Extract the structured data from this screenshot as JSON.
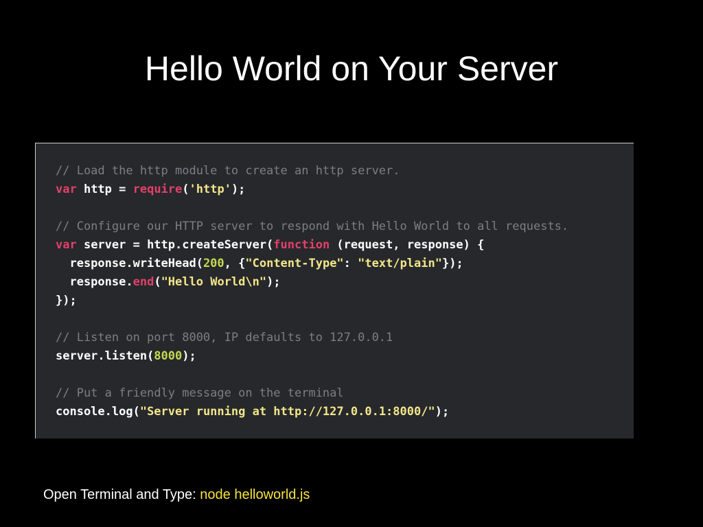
{
  "slide": {
    "title": "Hello World on Your Server"
  },
  "code": {
    "lines": [
      [
        {
          "t": "// Load the http module to create an http server.",
          "k": "comment"
        }
      ],
      [
        {
          "t": "var",
          "k": "keyword"
        },
        {
          "t": " http = ",
          "k": "plain"
        },
        {
          "t": "require",
          "k": "builtin"
        },
        {
          "t": "(",
          "k": "plain"
        },
        {
          "t": "'http'",
          "k": "string"
        },
        {
          "t": ");",
          "k": "plain"
        }
      ],
      [],
      [
        {
          "t": "// Configure our HTTP server to respond with Hello World to all requests.",
          "k": "comment"
        }
      ],
      [
        {
          "t": "var",
          "k": "keyword"
        },
        {
          "t": " server = http.createServer(",
          "k": "plain"
        },
        {
          "t": "function",
          "k": "keyword"
        },
        {
          "t": " (request, response) {",
          "k": "plain"
        }
      ],
      [
        {
          "t": "  response.writeHead(",
          "k": "plain"
        },
        {
          "t": "200",
          "k": "number"
        },
        {
          "t": ", {",
          "k": "plain"
        },
        {
          "t": "\"Content-Type\"",
          "k": "string"
        },
        {
          "t": ": ",
          "k": "plain"
        },
        {
          "t": "\"text/plain\"",
          "k": "string"
        },
        {
          "t": "});",
          "k": "plain"
        }
      ],
      [
        {
          "t": "  response.",
          "k": "plain"
        },
        {
          "t": "end",
          "k": "builtin"
        },
        {
          "t": "(",
          "k": "plain"
        },
        {
          "t": "\"Hello World\\n\"",
          "k": "string"
        },
        {
          "t": ");",
          "k": "plain"
        }
      ],
      [
        {
          "t": "});",
          "k": "plain"
        }
      ],
      [],
      [
        {
          "t": "// Listen on port 8000, IP defaults to 127.0.0.1",
          "k": "comment"
        }
      ],
      [
        {
          "t": "server.listen(",
          "k": "plain"
        },
        {
          "t": "8000",
          "k": "number"
        },
        {
          "t": ");",
          "k": "plain"
        }
      ],
      [],
      [
        {
          "t": "// Put a friendly message on the terminal",
          "k": "comment"
        }
      ],
      [
        {
          "t": "console.log(",
          "k": "plain"
        },
        {
          "t": "\"Server running at http://127.0.0.1:8000/\"",
          "k": "string"
        },
        {
          "t": ");",
          "k": "plain"
        }
      ]
    ]
  },
  "footer": {
    "instruction_label": "Open Terminal and Type: ",
    "command": "node helloworld.js"
  },
  "colors": {
    "background": "#000000",
    "code_background": "#26282b",
    "comment": "#7b7f86",
    "keyword": "#e2406a",
    "string": "#f3e68a",
    "number": "#c6d94f",
    "command_highlight": "#f5e53c"
  }
}
